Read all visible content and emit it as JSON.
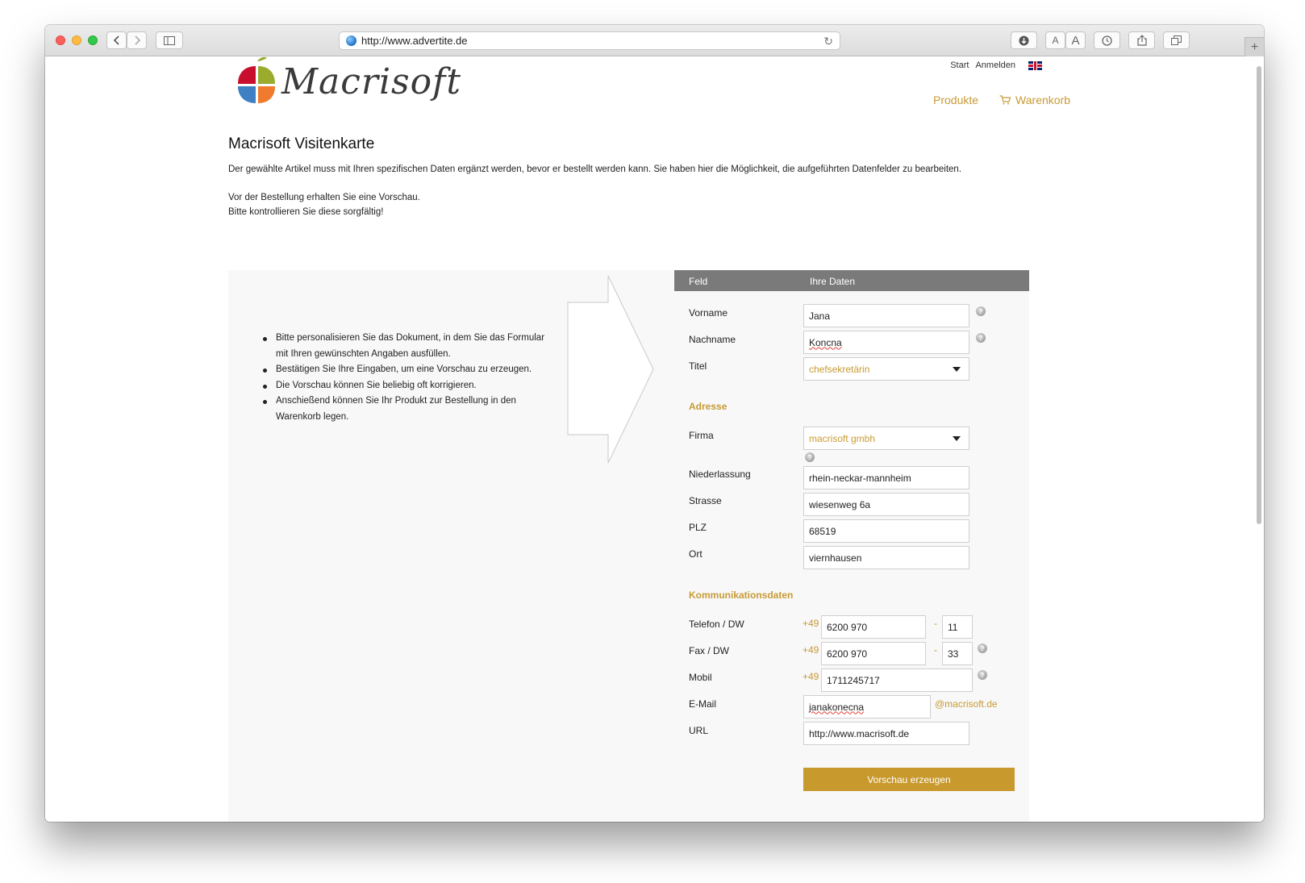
{
  "browser": {
    "url": "http://www.advertite.de",
    "reader_small": "A",
    "reader_large": "A",
    "new_tab": "+"
  },
  "header": {
    "logo_text": "Macrisoft",
    "top_links": [
      "Start",
      "Anmelden"
    ],
    "nav": {
      "products": "Produkte",
      "cart": "Warenkorb"
    }
  },
  "page": {
    "title": "Macrisoft Visitenkarte",
    "intro_1": "Der gewählte Artikel muss mit Ihren spezifischen Daten ergänzt werden, bevor er bestellt werden kann. Sie haben hier die Möglichkeit, die aufgeführten Datenfelder zu bearbeiten.",
    "intro_2": "Vor der Bestellung erhalten Sie eine Vorschau.",
    "intro_3": "Bitte kontrollieren Sie diese sorgfältig!"
  },
  "instructions": [
    "Bitte personalisieren Sie das Dokument, in dem Sie das Formular mit Ihren gewünschten Angaben ausfüllen.",
    "Bestätigen Sie Ihre Eingaben, um eine Vorschau zu erzeugen.",
    "Die Vorschau können Sie beliebig oft korrigieren.",
    "Anschießend können Sie Ihr Produkt zur Bestellung in den Warenkorb legen."
  ],
  "form": {
    "col_field": "Feld",
    "col_data": "Ihre Daten",
    "help_glyph": "?",
    "vorname": {
      "label": "Vorname",
      "value": "Jana"
    },
    "nachname": {
      "label": "Nachname",
      "value": "Koncna"
    },
    "titel": {
      "label": "Titel",
      "value": "chefsekretärin"
    },
    "section_address": "Adresse",
    "firma": {
      "label": "Firma",
      "value": "macrisoft gmbh"
    },
    "niederlassung": {
      "label": "Niederlassung",
      "value": "rhein-neckar-mannheim"
    },
    "strasse": {
      "label": "Strasse",
      "value": "wiesenweg 6a"
    },
    "plz": {
      "label": "PLZ",
      "value": "68519"
    },
    "ort": {
      "label": "Ort",
      "value": "viernhausen"
    },
    "section_comm": "Kommunikationsdaten",
    "telefon": {
      "label": "Telefon / DW",
      "prefix": "+49",
      "value": "6200 970",
      "sep": "-",
      "ext": "11"
    },
    "fax": {
      "label": "Fax / DW",
      "prefix": "+49",
      "value": "6200 970",
      "sep": "-",
      "ext": "33"
    },
    "mobil": {
      "label": "Mobil",
      "prefix": "+49",
      "value": "1711245717"
    },
    "email": {
      "label": "E-Mail",
      "value": "janakonecna",
      "domain": "@macrisoft.de"
    },
    "url": {
      "label": "URL",
      "value": "http://www.macrisoft.de"
    },
    "submit_label": "Vorschau erzeugen"
  },
  "colors": {
    "accent": "#c89a34",
    "header_gray": "#7a7a7a",
    "panel": "#f8f8f8"
  }
}
